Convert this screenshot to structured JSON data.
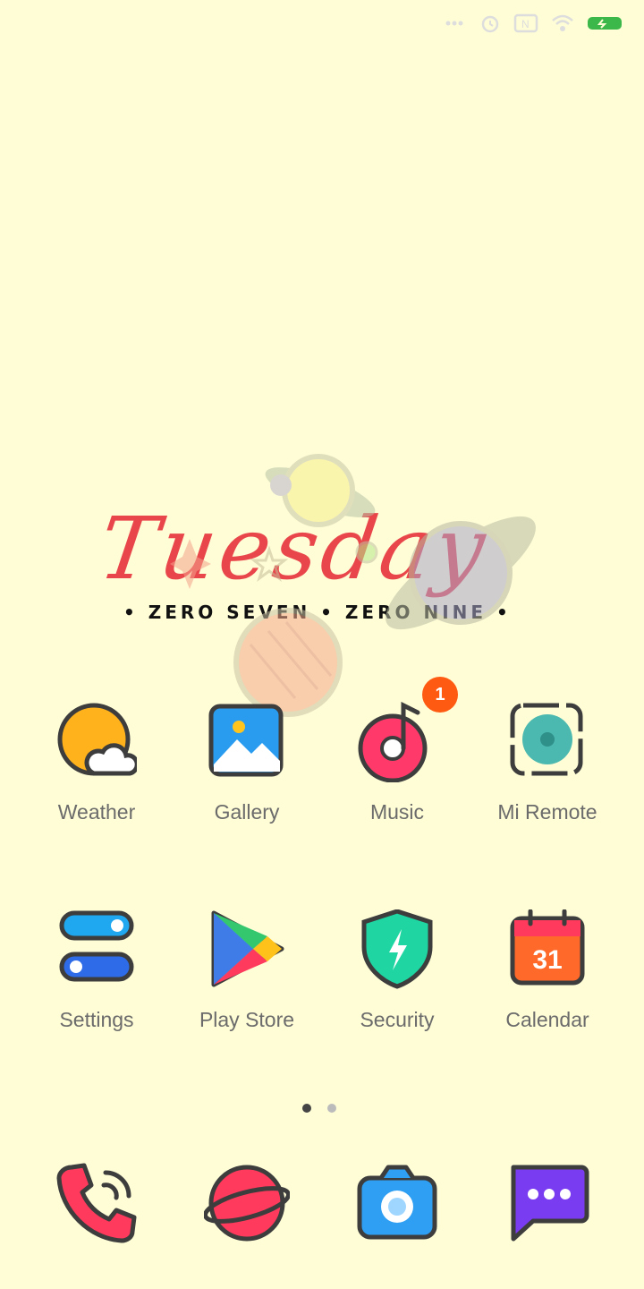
{
  "status_bar": {
    "icons": [
      "signal-dots-icon",
      "alarm-icon",
      "nfc-icon",
      "wifi-icon",
      "battery-icon"
    ],
    "battery_color": "#3cb84a"
  },
  "date_widget": {
    "day": "Tuesday",
    "date_line": "• ZERO SEVEN • ZERO NINE •"
  },
  "apps_row1": [
    {
      "label": "Weather",
      "icon": "weather-icon"
    },
    {
      "label": "Gallery",
      "icon": "gallery-icon"
    },
    {
      "label": "Music",
      "icon": "music-icon",
      "badge": "1"
    },
    {
      "label": "Mi Remote",
      "icon": "mi-remote-icon"
    }
  ],
  "apps_row2": [
    {
      "label": "Settings",
      "icon": "settings-icon"
    },
    {
      "label": "Play Store",
      "icon": "play-store-icon"
    },
    {
      "label": "Security",
      "icon": "security-icon"
    },
    {
      "label": "Calendar",
      "icon": "calendar-icon",
      "calendar_day": "31"
    }
  ],
  "page_indicator": {
    "pages": 2,
    "active": 1
  },
  "dock": [
    "phone-icon",
    "browser-icon",
    "camera-icon",
    "messages-icon"
  ],
  "colors": {
    "background": "#fffdd6",
    "accent_red": "#e8464b",
    "badge": "#ff5a12",
    "outline": "#3d3d3d"
  }
}
